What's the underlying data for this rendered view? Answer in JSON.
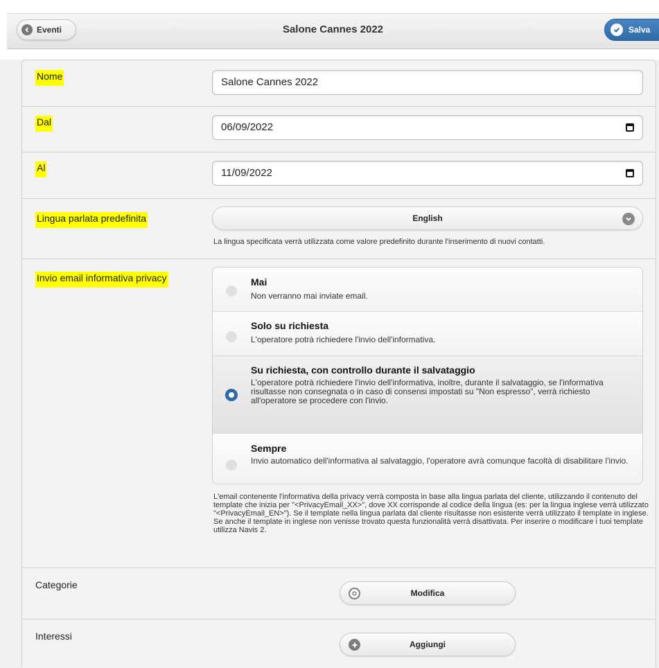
{
  "header": {
    "back_label": "Eventi",
    "title": "Salone Cannes 2022",
    "save_label": "Salva"
  },
  "form": {
    "nome": {
      "label": "Nome",
      "value": "Salone Cannes 2022"
    },
    "dal": {
      "label": "Dal",
      "value": "06/09/2022"
    },
    "al": {
      "label": "Al",
      "value": "11/09/2022"
    },
    "lingua": {
      "label": "Lingua parlata predefinita",
      "selected": "English",
      "help": "La lingua specificata verrà utilizzata come valore predefinito durante l'inserimento di nuovi contatti."
    },
    "privacy": {
      "label": "Invio email informativa privacy",
      "options": [
        {
          "title": "Mai",
          "desc": "Non verranno mai inviate email.",
          "selected": false
        },
        {
          "title": "Solo su richiesta",
          "desc": "L'operatore potrà richiedere l'invio dell'informativa.",
          "selected": false
        },
        {
          "title": "Su richiesta, con controllo durante il salvataggio",
          "desc": "L'operatore potrà richiedere l'invio dell'informativa, inoltre, durante il salvataggio, se l'informativa risultasse non consegnata o in caso di consensi impostati su \"Non espresso\", verrà richiesto all'operatore se procedere con l'invio.",
          "selected": true
        },
        {
          "title": "Sempre",
          "desc": "Invio automatico dell'informativa al salvataggio, l'operatore avrà comunque facoltà di disabilitare l'invio.",
          "selected": false
        }
      ],
      "help": "L'email contenente l'informativa della privacy verrà composta in base alla lingua parlata del cliente, utilizzando il contenuto del template che inizia per \"<PrivacyEmail_XX>\", dove XX corrisponde al codice della lingua (es: per la lingua inglese verrà utilizzato \"<PrivacyEmail_EN>\"). Se il template nella lingua parlata dal cliente risultasse non esistente verrà utilizzato il template in inglese. Se anche il template in inglese non venisse trovato questa funzionalità verrà disattivata. Per inserire o modificare i tuoi template utilizza Navis 2."
    },
    "categorie": {
      "label": "Categorie",
      "button": "Modifica"
    },
    "interessi": {
      "label": "Interessi",
      "button": "Aggiungi"
    }
  },
  "colors": {
    "highlight": "#ffff00",
    "accent": "#2e6aa6"
  }
}
